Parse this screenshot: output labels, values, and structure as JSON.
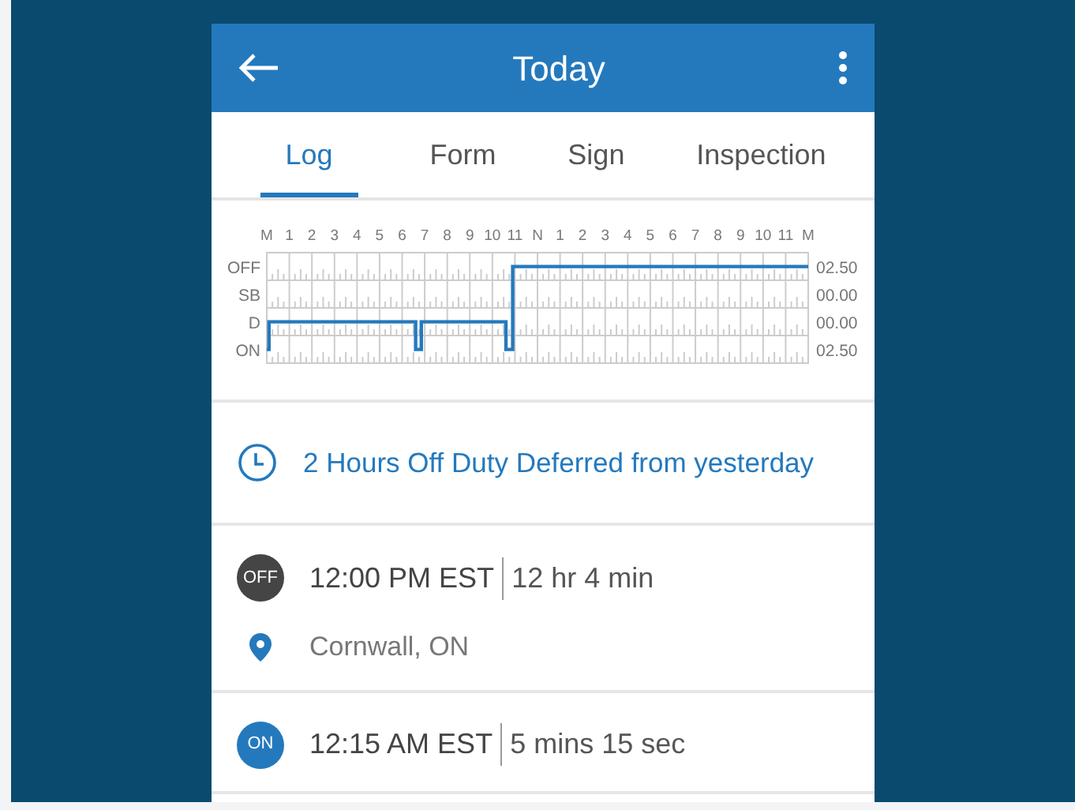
{
  "header": {
    "title": "Today"
  },
  "tabs": [
    {
      "label": "Log",
      "selected": true
    },
    {
      "label": "Form",
      "selected": false
    },
    {
      "label": "Sign",
      "selected": false
    },
    {
      "label": "Inspection",
      "selected": false
    }
  ],
  "log_graph": {
    "hour_labels": [
      "M",
      "1",
      "2",
      "3",
      "4",
      "5",
      "6",
      "7",
      "8",
      "9",
      "10",
      "11",
      "N",
      "1",
      "2",
      "3",
      "4",
      "5",
      "6",
      "7",
      "8",
      "9",
      "10",
      "11",
      "M"
    ],
    "status_labels": [
      "OFF",
      "SB",
      "D",
      "ON"
    ],
    "totals": [
      "02.50",
      "00.00",
      "00.00",
      "02.50"
    ]
  },
  "deferred": {
    "text": "2 Hours Off Duty Deferred from yesterday"
  },
  "entries": [
    {
      "kind": "off",
      "badge": "OFF",
      "time": "12:00 PM EST",
      "duration": "12 hr 4 min",
      "location": "Cornwall, ON"
    },
    {
      "kind": "on",
      "badge": "ON",
      "time": "12:15 AM EST",
      "duration": "5 mins 15 sec"
    }
  ]
}
